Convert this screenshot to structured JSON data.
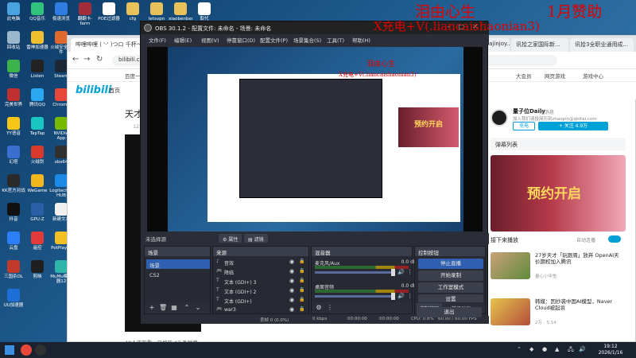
{
  "desktop": {
    "icons": [
      {
        "label": "此电脑",
        "color": "#4aa3df"
      },
      {
        "label": "QQ音乐",
        "color": "#31c27c"
      },
      {
        "label": "极速浏览",
        "color": "#2f7de1"
      },
      {
        "label": "翻翻卡-farm",
        "color": "#a32c3a"
      },
      {
        "label": "POE过滤器",
        "color": "#ffffff"
      },
      {
        "label": "cfg",
        "color": "#e8c15a"
      },
      {
        "label": "letsvpn",
        "color": "#e8c15a"
      },
      {
        "label": "xiaobenben",
        "color": "#e8c15a"
      },
      {
        "label": "取代",
        "color": "#ffffff"
      },
      {
        "label": "回收站",
        "color": "#9bb7cc"
      },
      {
        "label": "雷神加速器",
        "color": "#f0c030"
      },
      {
        "label": "火绒安全软件",
        "color": "#e06a2e"
      },
      {
        "label": "微信",
        "color": "#3bb34a"
      },
      {
        "label": "Listen",
        "color": "#222222"
      },
      {
        "label": "Steam",
        "color": "#1b2838"
      },
      {
        "label": "完美世界",
        "color": "#c03030"
      },
      {
        "label": "腾讯QQ",
        "color": "#2aa8f0"
      },
      {
        "label": "Chrome",
        "color": "#e8483b"
      },
      {
        "label": "YY语音",
        "color": "#f5c518"
      },
      {
        "label": "TapTap",
        "color": "#18c5c0"
      },
      {
        "label": "NVIDIA App",
        "color": "#76b900"
      },
      {
        "label": "幻塔",
        "color": "#3a6fd0"
      },
      {
        "label": "火绒剑",
        "color": "#d93a2e"
      },
      {
        "label": "obs64",
        "color": "#303030"
      },
      {
        "label": "KK官方对战",
        "color": "#2a2a2a"
      },
      {
        "label": "WeGame",
        "color": "#f1b71c"
      },
      {
        "label": "Logitech G HUB",
        "color": "#1e88e5"
      },
      {
        "label": "抖音",
        "color": "#111111"
      },
      {
        "label": "GPU-Z",
        "color": "#2b5ea7"
      },
      {
        "label": "新建文本",
        "color": "#f0f0f0"
      },
      {
        "label": "云盘",
        "color": "#2d7ff9"
      },
      {
        "label": "遥控",
        "color": "#e33b3b"
      },
      {
        "label": "PotPlayer",
        "color": "#f3c024"
      },
      {
        "label": "三国杀OL",
        "color": "#c0392b"
      },
      {
        "label": "剪映",
        "color": "#1f1f1f"
      },
      {
        "label": "MuMu模拟器12",
        "color": "#2fb5a9"
      },
      {
        "label": "UU加速器",
        "color": "#1f6fd9"
      }
    ]
  },
  "overlay": {
    "line1": "泪由心生",
    "line1_extra": "1月赞助",
    "line2": "X充电+V(.liancaishaonian3)"
  },
  "browser": {
    "tabs": [
      "哔哩哔哩 ( '-' )つロ 千杯～",
      "Builds - Umajinjoy...",
      "讯拾之家国际新...",
      "讯拾3全职业通用成..."
    ],
    "url": "bilibili.com/",
    "bookmarks": [
      "百度一下,你就知道",
      "大会员",
      "网页游戏",
      "游戏中心"
    ],
    "nav_logo": "bilibili",
    "nav_text": "首页",
    "video_title_prefix": "天才的",
    "video_sub": "12.5万",
    "video_bottom": "40人正在看 · 已填装 47 条弹幕",
    "sidebar": {
      "author": "量子位Daily",
      "live_tag": "发消息",
      "desc": "加入我们请投简历到zhaopin@qbitai.com",
      "btn_charge": "充电",
      "btn_follow": "+ 关注 4.9万",
      "danmaku_list": "弹幕列表",
      "banner_text": "预约开启",
      "next_label": "接下来播放",
      "autoplay": "自动连播",
      "items": [
        {
          "title": "27岁天才「玩跟周」放弃 OpenAI天价期权加入腾讯",
          "meta": "量心小甲鱼",
          "dur": "14:24"
        },
        {
          "title": "韩媒：因抄袭中国AI模型，Naver Cloud被起诉",
          "meta": "2万 · 5:14",
          "dur": "13:38"
        }
      ]
    }
  },
  "obs": {
    "title": "OBS 30.1.2 - 配置文件: 未命名 - 场景: 未命名",
    "menu": [
      "文件(F)",
      "编辑(E)",
      "视图(V)",
      "停靠窗口(D)",
      "配置文件(P)",
      "场景集合(S)",
      "工具(T)",
      "帮助(H)"
    ],
    "preview_overlay_1": "泪由心生",
    "preview_overlay_2": "X充电+V(.liancaishaonian3)",
    "preview_banner": "预约开启",
    "source_selected_label": "未选择源",
    "btn_properties": "属性",
    "btn_filters": "滤镜",
    "scenes": {
      "title": "场景",
      "items": [
        "场景",
        "CS2"
      ],
      "selected_index": 0
    },
    "sources": {
      "title": "来源",
      "items": [
        "音效",
        "降临",
        "文本 (GDI+) 3",
        "文本 (GDI+) 2",
        "文本 (GDI+)",
        "war3"
      ]
    },
    "mixer": {
      "title": "混音器",
      "channels": [
        {
          "name": "麦克风/Aux",
          "db": "0.0 dB"
        },
        {
          "name": "桌面音频",
          "db": "0.0 dB"
        }
      ]
    },
    "controls": {
      "title": "控制按钮",
      "buttons": [
        "停止直播",
        "开始录制",
        "工作室模式",
        "设置",
        "退出"
      ],
      "tab1": "控制按钮",
      "tab2": "转场动画"
    },
    "status": {
      "dropped": "丢帧 0 (0.0%)",
      "kbps": "0 kbps",
      "time1": "00:00:00",
      "time2": "00:00:00",
      "cpu": "CPU: 0.8%",
      "fps": "60.00 / 60.00 FPS"
    }
  },
  "taskbar": {
    "time": "19:12",
    "date": "2026/1/16"
  }
}
